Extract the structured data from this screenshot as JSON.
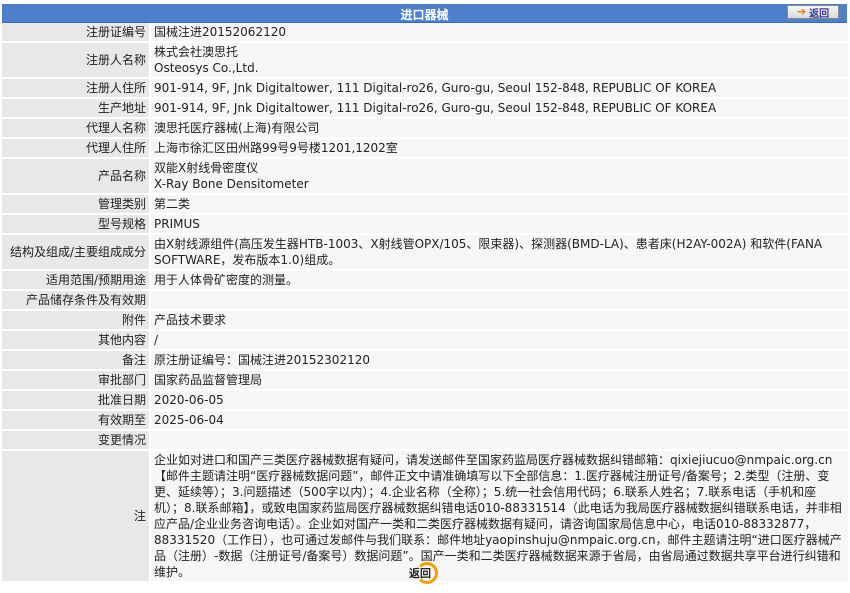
{
  "header": {
    "title": "进口器械",
    "back_label": "返回"
  },
  "rows": [
    {
      "label": "注册证编号",
      "value": "国械注进20152062120"
    },
    {
      "label": "注册人名称",
      "value": "株式会社澳思托\nOsteosys Co.,Ltd."
    },
    {
      "label": "注册人住所",
      "value": "901-914, 9F, Jnk Digitaltower, 111 Digital-ro26, Guro-gu, Seoul 152-848, REPUBLIC OF KOREA"
    },
    {
      "label": "生产地址",
      "value": "901-914, 9F, Jnk Digitaltower, 111 Digital-ro26, Guro-gu, Seoul 152-848, REPUBLIC OF KOREA"
    },
    {
      "label": "代理人名称",
      "value": "澳思托医疗器械(上海)有限公司"
    },
    {
      "label": "代理人住所",
      "value": "上海市徐汇区田州路99号9号楼1201,1202室"
    },
    {
      "label": "产品名称",
      "value": "双能X射线骨密度仪\nX-Ray Bone Densitometer"
    },
    {
      "label": "管理类别",
      "value": "第二类"
    },
    {
      "label": "型号规格",
      "value": "PRIMUS"
    },
    {
      "label": "结构及组成/主要组成成分",
      "value": "由X射线源组件(高压发生器HTB-1003、X射线管OPX/105、限束器)、探测器(BMD-LA)、患者床(H2AY-002A) 和软件(FANA SOFTWARE，发布版本1.0)组成。"
    },
    {
      "label": "适用范围/预期用途",
      "value": "用于人体骨矿密度的测量。"
    },
    {
      "label": "产品储存条件及有效期",
      "value": ""
    },
    {
      "label": "附件",
      "value": "产品技术要求"
    },
    {
      "label": "其他内容",
      "value": "/"
    },
    {
      "label": "备注",
      "value": "原注册证编号：国械注进20152302120"
    },
    {
      "label": "审批部门",
      "value": "国家药品监督管理局"
    },
    {
      "label": "批准日期",
      "value": "2020-06-05"
    },
    {
      "label": "有效期至",
      "value": "2025-06-04"
    },
    {
      "label": "变更情况",
      "value": ""
    }
  ],
  "note": {
    "label": "注",
    "text": "企业如对进口和国产三类医疗器械数据有疑问，请发送邮件至国家药监局医疗器械数据纠错邮箱：qixiejiucuo@nmpaic.org.cn【邮件主题请注明“医疗器械数据问题”，邮件正文中请准确填写以下全部信息：1.医疗器械注册证号/备案号；2.类型（注册、变更、延续等）；3.问题描述（500字以内）；4.企业名称（全称）；5.统一社会信用代码；6.联系人姓名；7.联系电话（手机和座机）；8.联系邮箱】，或致电国家药监局医疗器械数据纠错电话010-88331514（此电话为我局医疗器械数据纠错联系电话，并非相应产品/企业业务咨询电话）。企业如对国产一类和二类医疗器械数据有疑问，请咨询国家局信息中心，电话010-88332877，88331520（工作日），也可通过发邮件与我们联系：邮件地址yaopinshuju@nmpaic.org.cn，邮件主题请注明“进口医疗器械产品（注册）-数据（注册证号/备案号）数据问题”。国产一类和二类医疗器械数据来源于省局，由省局通过数据共享平台进行纠错和维护。"
  },
  "footer": {
    "back_label": "返回"
  },
  "colors": {
    "header_bg": "#4d7fcc",
    "label_bg": "#e8e8e8",
    "value_bg": "#f6f6f6",
    "back_ring": "#f0a000"
  }
}
